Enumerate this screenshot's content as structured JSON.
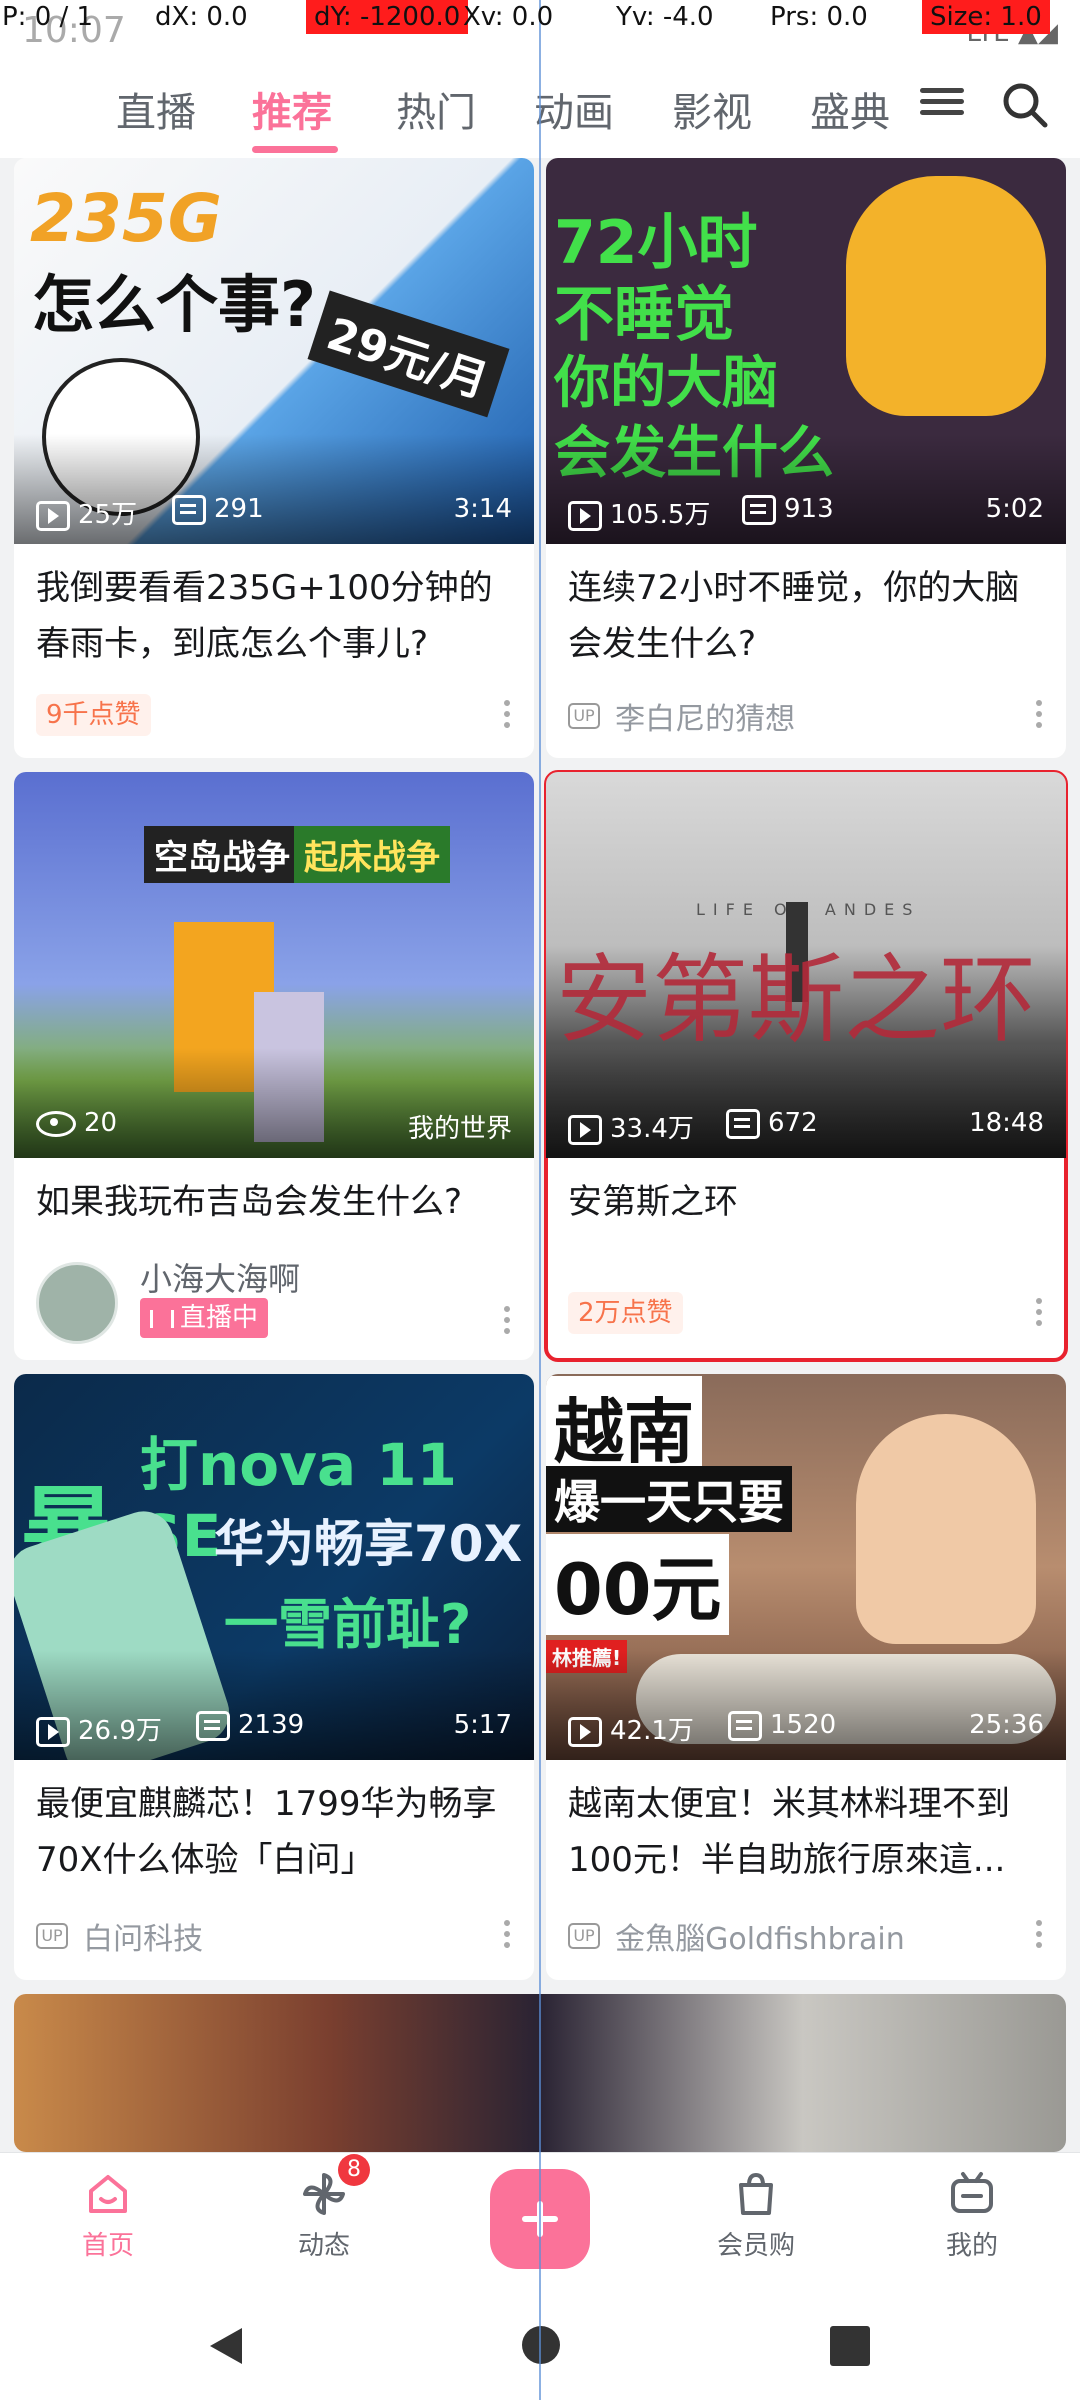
{
  "debug": {
    "pointer": "P: 0 / 1",
    "dx": "dX: 0.0",
    "dy": "dY: -1200.0",
    "xv": "Xv: 0.0",
    "yv": "Yv: -4.0",
    "prs": "Prs: 0.0",
    "size": "Size: 1.0"
  },
  "status": {
    "time": "10:07",
    "signal": "LTE ▲◢"
  },
  "tabs": [
    "直播",
    "推荐",
    "热门",
    "动画",
    "影视",
    "盛典"
  ],
  "active_tab_index": 1,
  "cards": [
    {
      "thumb_text_1": "235G",
      "thumb_text_2": "怎么个事?",
      "thumb_text_3": "29元/月",
      "plays": "25万",
      "danmaku": "291",
      "duration": "3:14",
      "title": "我倒要看看235G+100分钟的春雨卡，到底怎么个事儿?",
      "likes": "9千点赞"
    },
    {
      "thumb_text_1": "72小时",
      "thumb_text_2": "不睡觉",
      "thumb_text_3": "你的大脑",
      "thumb_text_4": "会发生什么",
      "plays": "105.5万",
      "danmaku": "913",
      "duration": "5:02",
      "title": "连续72小时不睡觉，你的大脑会发生什么?",
      "uploader": "李白尼的猜想"
    },
    {
      "thumb_text_1": "空岛战争",
      "thumb_text_2": "起床战争",
      "views": "20",
      "category": "我的世界",
      "title": "如果我玩布吉岛会发生什么?",
      "uploader": "小海大海啊",
      "live_label": "直播中"
    },
    {
      "thumb_text_1": "安第斯之环",
      "thumb_text_2": "LIFE OF ANDES",
      "plays": "33.4万",
      "danmaku": "672",
      "duration": "18:48",
      "title": "安第斯之环",
      "likes": "2万点赞"
    },
    {
      "thumb_text_1": "打nova 11 SE",
      "thumb_text_2": "华为畅享70X",
      "thumb_text_3": "暴",
      "thumb_text_4": "一雪前耻?",
      "plays": "26.9万",
      "danmaku": "2139",
      "duration": "5:17",
      "title": "最便宜麒麟芯！1799华为畅享70X什么体验「白问」",
      "uploader": "白问科技"
    },
    {
      "thumb_text_1": "越南",
      "thumb_text_2": "爆一天只要",
      "thumb_text_3": "00元",
      "thumb_text_4": "林推薦!",
      "plays": "42.1万",
      "danmaku": "1520",
      "duration": "25:36",
      "title": "越南太便宜！米其林料理不到100元！半自助旅行原來這...",
      "uploader": "金魚腦Goldfishbrain"
    }
  ],
  "bottom_nav": [
    {
      "label": "首页"
    },
    {
      "label": "动态",
      "badge": "8"
    },
    {
      "label": ""
    },
    {
      "label": "会员购"
    },
    {
      "label": "我的"
    }
  ],
  "colors": {
    "accent": "#fb7299",
    "like_text": "#f7734b",
    "highlight": "#e8222e"
  }
}
